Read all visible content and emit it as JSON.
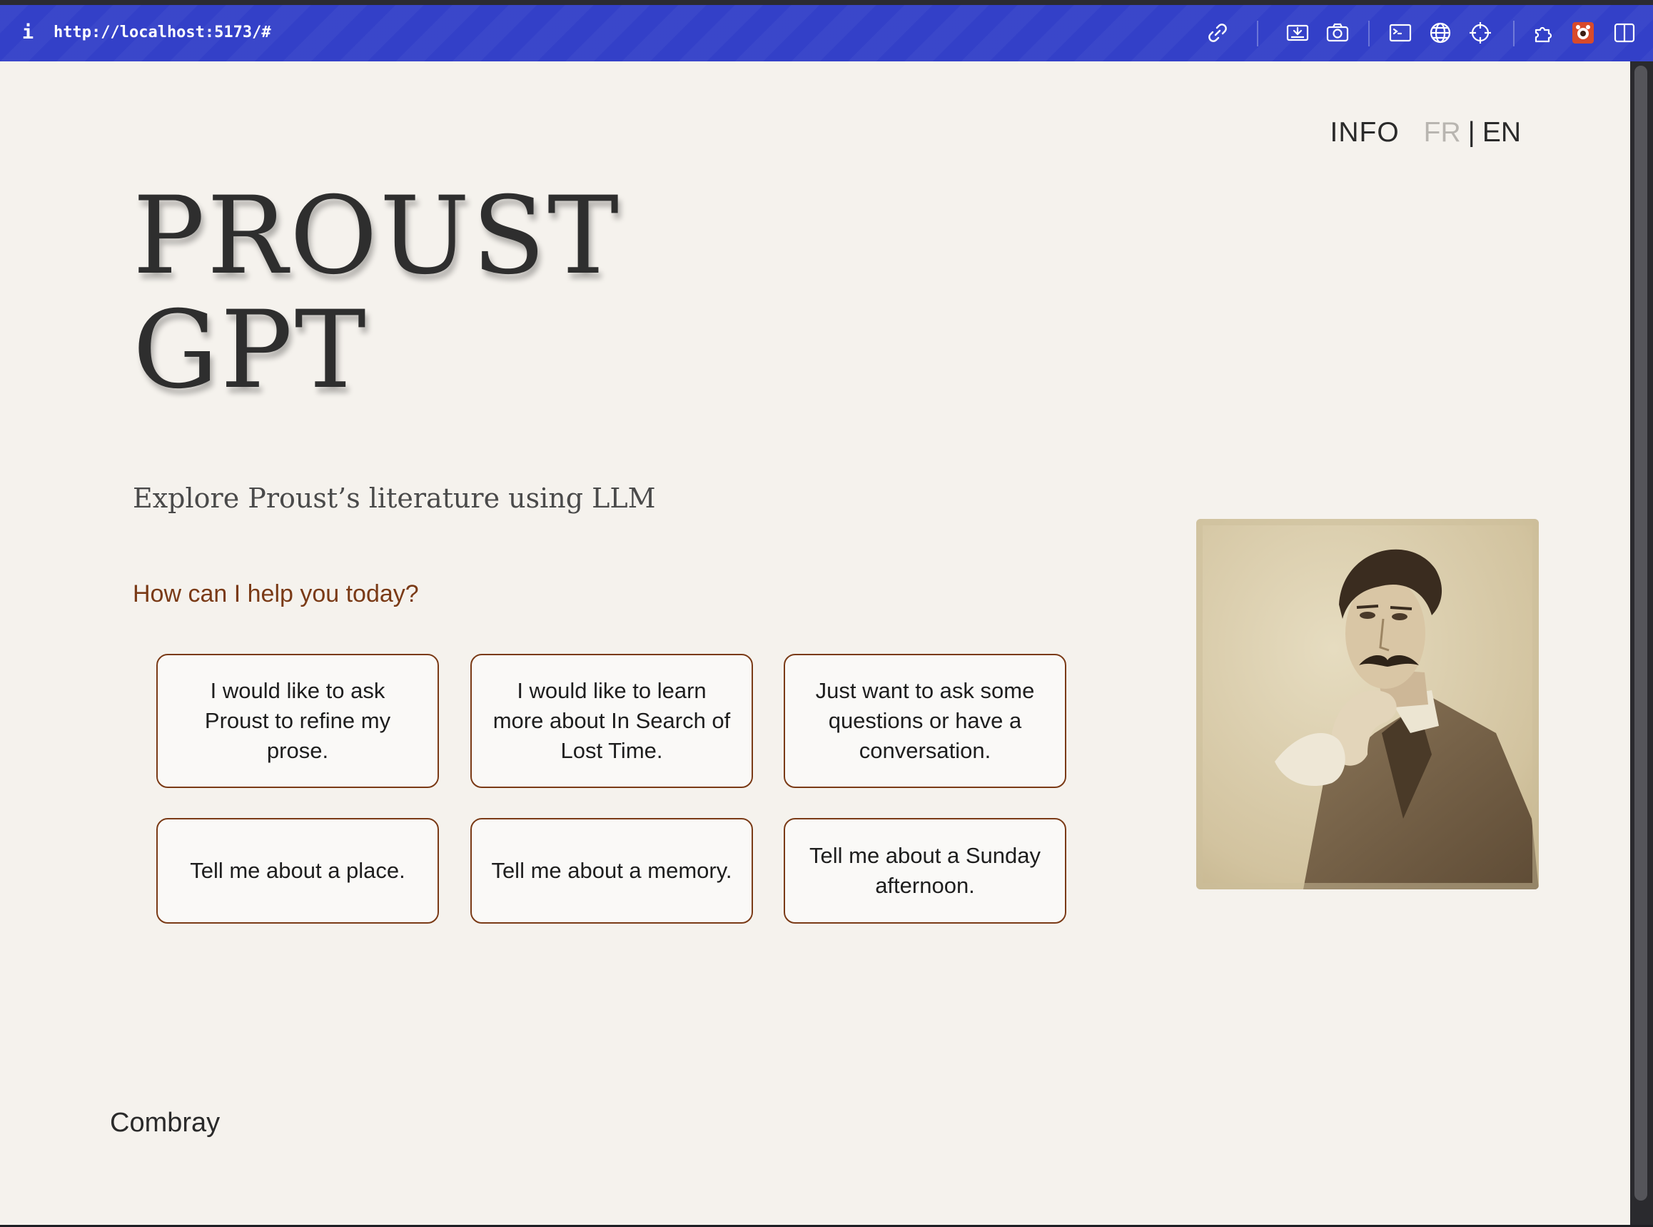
{
  "browser": {
    "info_glyph": "i",
    "url": "http://localhost:5173/#"
  },
  "nav": {
    "info": "INFO",
    "lang_fr": "FR",
    "separator": "|",
    "lang_en": "EN"
  },
  "hero": {
    "title_line1": "PROUST",
    "title_line2": "GPT",
    "subtitle": "Explore Proust’s literature using LLM"
  },
  "prompt": "How can I help you today?",
  "suggestions": [
    "I would like to ask Proust to refine my prose.",
    "I would like to learn more about In Search of Lost Time.",
    "Just want to ask some questions or have a conversation.",
    "Tell me about a place.",
    "Tell me about a memory.",
    "Tell me about a Sunday afternoon."
  ],
  "footer": "Combray",
  "colors": {
    "browser_bar": "#3340c8",
    "page_bg": "#f5f2ed",
    "accent_brown": "#7a3a16",
    "lang_inactive": "#b8b5b0"
  },
  "icons": [
    "link-icon",
    "screenshot-icon",
    "camera-icon",
    "terminal-icon",
    "globe-icon",
    "crosshair-icon",
    "extensions-icon",
    "extension-badge-icon",
    "sidebar-icon"
  ]
}
